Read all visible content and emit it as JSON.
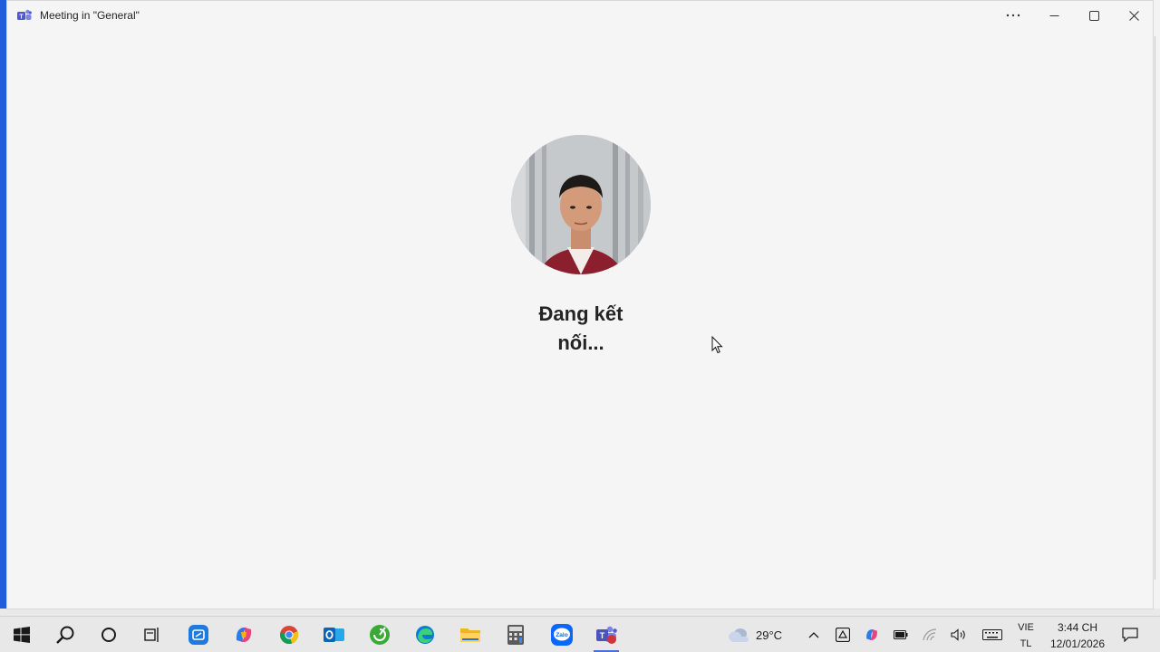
{
  "window": {
    "title": "Meeting in \"General\"",
    "more_icon": "more-horizontal-icon",
    "minimize_icon": "minimize-icon",
    "maximize_icon": "maximize-icon",
    "close_icon": "close-icon"
  },
  "meeting": {
    "status_line1": "Đang kết",
    "status_line2": "nối..."
  },
  "taskbar": {
    "apps": [
      {
        "name": "start-icon"
      },
      {
        "name": "search-icon"
      },
      {
        "name": "cortana-icon"
      },
      {
        "name": "task-view-icon"
      },
      {
        "name": "zoom-like-app-icon"
      },
      {
        "name": "copilot-icon"
      },
      {
        "name": "chrome-icon"
      },
      {
        "name": "outlook-icon"
      },
      {
        "name": "green-app-icon"
      },
      {
        "name": "edge-icon"
      },
      {
        "name": "file-explorer-icon"
      },
      {
        "name": "calculator-icon"
      },
      {
        "name": "zalo-icon",
        "label": "Zalo"
      },
      {
        "name": "teams-icon",
        "active": true
      }
    ],
    "weather": {
      "temp": "29°C"
    },
    "language": {
      "line1": "VIE",
      "line2": "TL"
    },
    "clock": {
      "time": "3:44 CH",
      "date": "12/01/2026"
    }
  }
}
